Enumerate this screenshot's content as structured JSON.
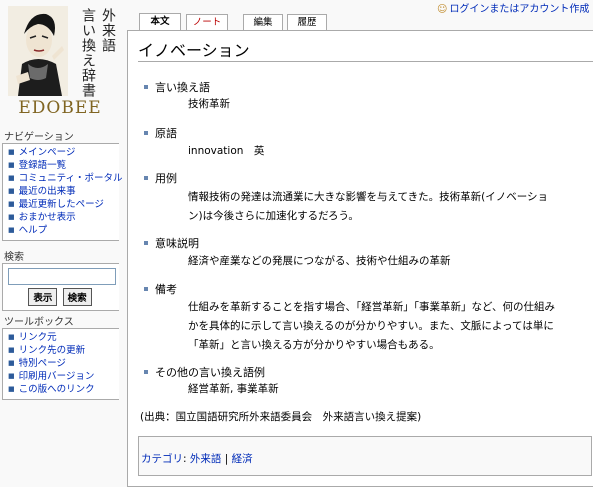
{
  "logo": {
    "vertical_text_right": "外来語",
    "vertical_text_left": "言い換え辞書",
    "brand": "EDOBEE"
  },
  "nav": {
    "title": "ナビゲーション",
    "items": [
      "メインページ",
      "登録語一覧",
      "コミュニティ・ポータル",
      "最近の出来事",
      "最近更新したページ",
      "おまかせ表示",
      "ヘルプ"
    ]
  },
  "search": {
    "title": "検索",
    "value": "",
    "go_label": "表示",
    "search_label": "検索"
  },
  "toolbox": {
    "title": "ツールボックス",
    "items": [
      "リンク元",
      "リンク先の更新",
      "特別ページ",
      "印刷用バージョン",
      "この版へのリンク"
    ]
  },
  "user": {
    "login": "ログインまたはアカウント作成"
  },
  "tabs": [
    "本文",
    "ノート",
    "編集",
    "履歴"
  ],
  "article": {
    "title": "イノベーション",
    "sections": [
      {
        "heading": "言い換え語",
        "lines": [
          "技術革新"
        ]
      },
      {
        "heading": "原語",
        "lines": [
          "innovation　英"
        ]
      },
      {
        "heading": "用例",
        "lines": [
          "情報技術の発達は流通業に大きな影響を与えてきた。技術革新(イノベーショ",
          "ン)は今後さらに加速化するだろう。"
        ]
      },
      {
        "heading": "意味説明",
        "lines": [
          "経済や産業などの発展につながる、技術や仕組みの革新"
        ]
      },
      {
        "heading": "備考",
        "lines": [
          "仕組みを革新することを指す場合、「経営革新」「事業革新」など、何の仕組み",
          "かを具体的に示して言い換えるのが分かりやすい。また、文脈によっては単に",
          "「革新」と言い換える方が分かりやすい場合もある。"
        ]
      },
      {
        "heading": "その他の言い換え語例",
        "lines": [
          "経営革新, 事業革新"
        ]
      }
    ],
    "source": "(出典：国立国語研究所外来語委員会　外来語言い換え提案)"
  },
  "categories": {
    "label": "カテゴリ",
    "items": [
      "外来語",
      "経済"
    ]
  }
}
